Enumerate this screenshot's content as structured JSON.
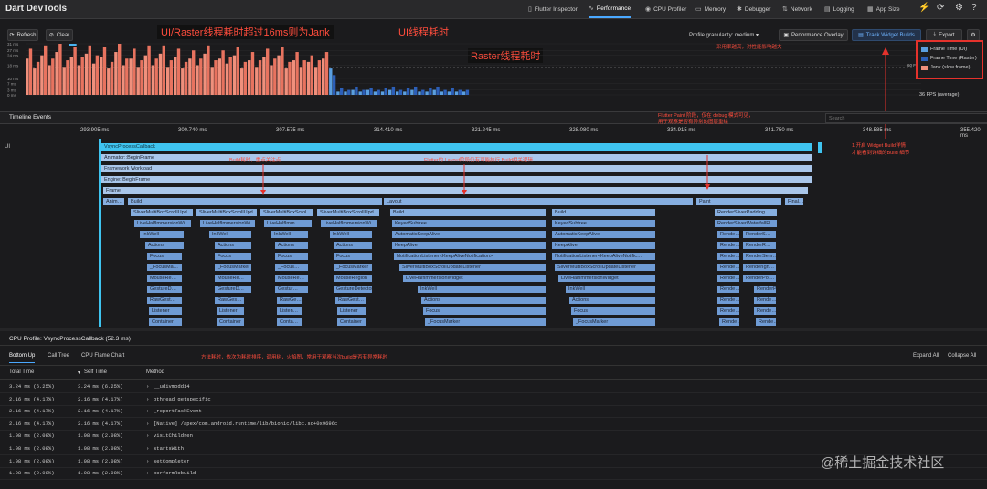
{
  "app": {
    "title": "Dart DevTools"
  },
  "nav": [
    {
      "label": "Flutter Inspector",
      "icon": "inspector-icon",
      "glyph": "▯"
    },
    {
      "label": "Performance",
      "icon": "performance-icon",
      "glyph": "∿"
    },
    {
      "label": "CPU Profiler",
      "icon": "cpu-icon",
      "glyph": "◉"
    },
    {
      "label": "Memory",
      "icon": "memory-icon",
      "glyph": "▭"
    },
    {
      "label": "Debugger",
      "icon": "debugger-icon",
      "glyph": "✱"
    },
    {
      "label": "Network",
      "icon": "network-icon",
      "glyph": "⇅"
    },
    {
      "label": "Logging",
      "icon": "logging-icon",
      "glyph": "▤"
    },
    {
      "label": "App Size",
      "icon": "app-size-icon",
      "glyph": "▦"
    }
  ],
  "toolbar": {
    "refresh_label": "Refresh",
    "clear_label": "Clear",
    "granularity_label": "Profile granularity: medium",
    "overlay_label": "Performance Overlay",
    "track_builds_label": "Track Widget Builds",
    "export_label": "Export"
  },
  "chart": {
    "y_ticks": [
      "31 ms",
      "27 ms",
      "24 ms",
      "18 ms",
      "10 ms",
      "7 ms",
      "3 ms",
      "0 ms"
    ],
    "fps_line_label": "60 FPS",
    "fps_avg": "36 FPS (average)",
    "legend": [
      {
        "label": "Frame Time (UI)",
        "color": "#5a9fe0"
      },
      {
        "label": "Frame Time (Raster)",
        "color": "#2c5fb8"
      },
      {
        "label": "Jank (slow frame)",
        "color": "#f0907c"
      }
    ]
  },
  "chart_data": {
    "type": "bar",
    "title": "",
    "ylabel": "",
    "ylim": [
      0,
      31
    ],
    "series": [
      {
        "name": "Frame Time (UI)",
        "values": [
          22,
          16,
          24,
          18,
          26,
          17,
          23,
          18,
          25,
          19,
          23,
          16,
          26,
          18,
          22,
          17,
          24,
          18,
          25,
          17,
          23,
          16,
          22,
          18,
          25,
          17,
          22,
          19,
          24,
          16,
          21,
          17,
          23,
          18,
          24,
          16,
          21,
          17,
          20,
          17,
          22,
          16,
          2,
          2,
          3,
          2,
          3,
          2,
          2,
          3,
          2,
          2,
          3,
          2,
          2,
          3,
          2,
          2,
          2,
          2
        ]
      },
      {
        "name": "Frame Time (Raster)",
        "values": [
          28,
          20,
          30,
          22,
          31,
          21,
          29,
          23,
          30,
          24,
          29,
          20,
          31,
          22,
          28,
          21,
          30,
          22,
          30,
          21,
          28,
          20,
          27,
          22,
          30,
          21,
          27,
          23,
          29,
          20,
          26,
          21,
          28,
          22,
          29,
          20,
          26,
          21,
          24,
          21,
          26,
          12,
          4,
          3,
          5,
          3,
          4,
          3,
          4,
          5,
          3,
          4,
          5,
          3,
          4,
          5,
          3,
          4,
          3,
          3
        ]
      }
    ]
  },
  "annotations": {
    "jank_note": "UI/Raster线程耗时超过16ms则为Jank",
    "ui_thread_note": "UI线程耗时",
    "raster_thread_note": "Raster线程耗时",
    "sampling_note": "采用率越高，对性能影响越大",
    "build_note": "Build耗时，重点关注点",
    "layout_note": "Flutter的 Layout阶段仍有可能执行 Build相关逻辑",
    "paint_note_1": "Flutter Paint 阶段，仅在 debug 模式可见，",
    "paint_note_2": "用于观察是否有异常的图层重绘",
    "widget_build_note_1": "1.开启 Widget Build详情",
    "widget_build_note_2": "才能看到详细的Build 细节",
    "cpu_note": "方法耗时，依次为耗时排序，调用树，火焰图，常用于观察当次build是否有异常耗时"
  },
  "timeline": {
    "title": "Timeline Events",
    "search_placeholder": "Search",
    "thread_label": "UI",
    "ticks": [
      "293.905 ms",
      "300.740 ms",
      "307.575 ms",
      "314.410 ms",
      "321.245 ms",
      "328.080 ms",
      "334.915 ms",
      "341.750 ms",
      "348.585 ms",
      "355.420 ms"
    ]
  },
  "flame": [
    {
      "l": "VsyncProcessCallback",
      "c": "cyan",
      "x": 110,
      "y": 0,
      "w": 780
    },
    {
      "l": "Animator::BeginFrame",
      "c": "b1",
      "x": 110,
      "y": 12,
      "w": 780
    },
    {
      "l": "Framework Workload",
      "c": "b1",
      "x": 110,
      "y": 24,
      "w": 780
    },
    {
      "l": "Engine::BeginFrame",
      "c": "b1",
      "x": 110,
      "y": 36,
      "w": 780
    },
    {
      "l": "Frame",
      "c": "b1",
      "x": 112,
      "y": 48,
      "w": 773
    },
    {
      "l": "Anim…",
      "c": "b2",
      "x": 112,
      "y": 60,
      "w": 25
    },
    {
      "l": "Build",
      "c": "b2",
      "x": 139,
      "y": 60,
      "w": 280
    },
    {
      "l": "Layout",
      "c": "b2",
      "x": 419,
      "y": 60,
      "w": 340
    },
    {
      "l": "Paint",
      "c": "b2",
      "x": 761,
      "y": 60,
      "w": 95
    },
    {
      "l": "Final…",
      "c": "b2",
      "x": 858,
      "y": 60,
      "w": 22
    },
    {
      "l": "SliverMultiBoxScrollUpd…",
      "c": "b2",
      "x": 142,
      "y": 72,
      "w": 70
    },
    {
      "l": "SliverMultiBoxScrollUpd…",
      "c": "b2",
      "x": 214,
      "y": 72,
      "w": 68
    },
    {
      "l": "SliverMultiBoxScrol…",
      "c": "b2",
      "x": 284,
      "y": 72,
      "w": 60
    },
    {
      "l": "SliverMultiBoxScrollUpd…",
      "c": "b2",
      "x": 346,
      "y": 72,
      "w": 70
    },
    {
      "l": "Build",
      "c": "b2",
      "x": 426,
      "y": 72,
      "w": 172
    },
    {
      "l": "Build",
      "c": "b2",
      "x": 603,
      "y": 72,
      "w": 115
    },
    {
      "l": "RenderSliverPadding",
      "c": "b2",
      "x": 781,
      "y": 72,
      "w": 70
    },
    {
      "l": "LiveHalfImmersionWi…",
      "c": "b3",
      "x": 146,
      "y": 84,
      "w": 64
    },
    {
      "l": "LiveHalfImmersionWi…",
      "c": "b3",
      "x": 218,
      "y": 84,
      "w": 62
    },
    {
      "l": "LiveHalfImm…",
      "c": "b3",
      "x": 288,
      "y": 84,
      "w": 54
    },
    {
      "l": "LiveHalfImmersionWi…",
      "c": "b3",
      "x": 350,
      "y": 84,
      "w": 64
    },
    {
      "l": "KeyedSubtree",
      "c": "b3",
      "x": 428,
      "y": 84,
      "w": 170
    },
    {
      "l": "KeyedSubtree",
      "c": "b3",
      "x": 603,
      "y": 84,
      "w": 115
    },
    {
      "l": "RenderSliverWaterfallFl…",
      "c": "b3",
      "x": 781,
      "y": 84,
      "w": 70
    },
    {
      "l": "InkWell",
      "c": "b3",
      "x": 152,
      "y": 96,
      "w": 50
    },
    {
      "l": "InkWell",
      "c": "b3",
      "x": 228,
      "y": 96,
      "w": 48
    },
    {
      "l": "InkWell",
      "c": "b3",
      "x": 296,
      "y": 96,
      "w": 42
    },
    {
      "l": "InkWell",
      "c": "b3",
      "x": 360,
      "y": 96,
      "w": 48
    },
    {
      "l": "AutomaticKeepAlive",
      "c": "b3",
      "x": 428,
      "y": 96,
      "w": 170
    },
    {
      "l": "AutomaticKeepAlive",
      "c": "b3",
      "x": 603,
      "y": 96,
      "w": 115
    },
    {
      "l": "Rende…",
      "c": "b3",
      "x": 784,
      "y": 96,
      "w": 26
    },
    {
      "l": "RenderS…",
      "c": "b3",
      "x": 812,
      "y": 96,
      "w": 38
    },
    {
      "l": "Actions",
      "c": "b3",
      "x": 158,
      "y": 108,
      "w": 44
    },
    {
      "l": "Actions",
      "c": "b3",
      "x": 234,
      "y": 108,
      "w": 42
    },
    {
      "l": "Actions",
      "c": "b3",
      "x": 300,
      "y": 108,
      "w": 38
    },
    {
      "l": "Actions",
      "c": "b3",
      "x": 364,
      "y": 108,
      "w": 44
    },
    {
      "l": "KeepAlive",
      "c": "b3",
      "x": 428,
      "y": 108,
      "w": 170
    },
    {
      "l": "KeepAlive",
      "c": "b3",
      "x": 603,
      "y": 108,
      "w": 115
    },
    {
      "l": "Rende…",
      "c": "b3",
      "x": 784,
      "y": 108,
      "w": 26
    },
    {
      "l": "RenderR…",
      "c": "b3",
      "x": 812,
      "y": 108,
      "w": 38
    },
    {
      "l": "Focus",
      "c": "b3",
      "x": 160,
      "y": 120,
      "w": 40
    },
    {
      "l": "Focus",
      "c": "b3",
      "x": 234,
      "y": 120,
      "w": 42
    },
    {
      "l": "Focus",
      "c": "b3",
      "x": 300,
      "y": 120,
      "w": 38
    },
    {
      "l": "Focus",
      "c": "b3",
      "x": 364,
      "y": 120,
      "w": 44
    },
    {
      "l": "NotificationListener<KeepAliveNotification>",
      "c": "b3",
      "x": 430,
      "y": 120,
      "w": 168
    },
    {
      "l": "NotificationListener<KeepAliveNotific…",
      "c": "b3",
      "x": 603,
      "y": 120,
      "w": 115
    },
    {
      "l": "Rende…",
      "c": "b3",
      "x": 784,
      "y": 120,
      "w": 26
    },
    {
      "l": "RenderSem…",
      "c": "b3",
      "x": 812,
      "y": 120,
      "w": 38
    },
    {
      "l": "_FocusMa…",
      "c": "b3",
      "x": 160,
      "y": 132,
      "w": 40
    },
    {
      "l": "_FocusMarker",
      "c": "b3",
      "x": 234,
      "y": 132,
      "w": 42
    },
    {
      "l": "_Focus…",
      "c": "b3",
      "x": 300,
      "y": 132,
      "w": 38
    },
    {
      "l": "_FocusMarker",
      "c": "b3",
      "x": 364,
      "y": 132,
      "w": 44
    },
    {
      "l": "SliverMultiBoxScrollUpdateListener",
      "c": "b3",
      "x": 436,
      "y": 132,
      "w": 162
    },
    {
      "l": "SliverMultiBoxScrollUpdateListener",
      "c": "b3",
      "x": 606,
      "y": 132,
      "w": 112
    },
    {
      "l": "Rende…",
      "c": "b3",
      "x": 784,
      "y": 132,
      "w": 26
    },
    {
      "l": "RenderIgn…",
      "c": "b3",
      "x": 812,
      "y": 132,
      "w": 38
    },
    {
      "l": "MouseRe…",
      "c": "b3",
      "x": 160,
      "y": 144,
      "w": 40
    },
    {
      "l": "MouseRe…",
      "c": "b3",
      "x": 234,
      "y": 144,
      "w": 42
    },
    {
      "l": "MouseRe…",
      "c": "b3",
      "x": 300,
      "y": 144,
      "w": 38
    },
    {
      "l": "MouseRegion",
      "c": "b3",
      "x": 364,
      "y": 144,
      "w": 44
    },
    {
      "l": "LiveHalfImmersionWidget",
      "c": "b3",
      "x": 440,
      "y": 144,
      "w": 158
    },
    {
      "l": "LiveHalfImmersionWidget",
      "c": "b3",
      "x": 610,
      "y": 144,
      "w": 108
    },
    {
      "l": "Rende…",
      "c": "b3",
      "x": 784,
      "y": 144,
      "w": 26
    },
    {
      "l": "RenderPoi…",
      "c": "b3",
      "x": 812,
      "y": 144,
      "w": 38
    },
    {
      "l": "GestureD…",
      "c": "b3",
      "x": 160,
      "y": 156,
      "w": 40
    },
    {
      "l": "GestureD…",
      "c": "b3",
      "x": 234,
      "y": 156,
      "w": 42
    },
    {
      "l": "Gestur…",
      "c": "b3",
      "x": 300,
      "y": 156,
      "w": 38
    },
    {
      "l": "GestureDetector",
      "c": "b3",
      "x": 364,
      "y": 156,
      "w": 44
    },
    {
      "l": "InkWell",
      "c": "b3",
      "x": 456,
      "y": 156,
      "w": 142
    },
    {
      "l": "InkWell",
      "c": "b3",
      "x": 618,
      "y": 156,
      "w": 100
    },
    {
      "l": "Rende…",
      "c": "b3",
      "x": 784,
      "y": 156,
      "w": 26
    },
    {
      "l": "RenderPoi…",
      "c": "b3",
      "x": 824,
      "y": 156,
      "w": 26
    },
    {
      "l": "RawGest…",
      "c": "b3",
      "x": 160,
      "y": 168,
      "w": 40
    },
    {
      "l": "RawGes…",
      "c": "b3",
      "x": 234,
      "y": 168,
      "w": 34
    },
    {
      "l": "RawGe…",
      "c": "b3",
      "x": 302,
      "y": 168,
      "w": 30
    },
    {
      "l": "RawGest…",
      "c": "b3",
      "x": 366,
      "y": 168,
      "w": 36
    },
    {
      "l": "Actions",
      "c": "b3",
      "x": 460,
      "y": 168,
      "w": 138
    },
    {
      "l": "Actions",
      "c": "b3",
      "x": 622,
      "y": 168,
      "w": 96
    },
    {
      "l": "Rende…",
      "c": "b3",
      "x": 784,
      "y": 168,
      "w": 26
    },
    {
      "l": "Rende…",
      "c": "b3",
      "x": 824,
      "y": 168,
      "w": 26
    },
    {
      "l": "Listener",
      "c": "b3",
      "x": 162,
      "y": 180,
      "w": 38
    },
    {
      "l": "Listener",
      "c": "b3",
      "x": 236,
      "y": 180,
      "w": 32
    },
    {
      "l": "Listen…",
      "c": "b3",
      "x": 302,
      "y": 180,
      "w": 30
    },
    {
      "l": "Listener",
      "c": "b3",
      "x": 368,
      "y": 180,
      "w": 34
    },
    {
      "l": "Focus",
      "c": "b3",
      "x": 462,
      "y": 180,
      "w": 136
    },
    {
      "l": "Focus",
      "c": "b3",
      "x": 624,
      "y": 180,
      "w": 94
    },
    {
      "l": "Rende…",
      "c": "b3",
      "x": 784,
      "y": 180,
      "w": 26
    },
    {
      "l": "Rende…",
      "c": "b3",
      "x": 824,
      "y": 180,
      "w": 26
    },
    {
      "l": "Container",
      "c": "b3",
      "x": 162,
      "y": 192,
      "w": 38
    },
    {
      "l": "Container",
      "c": "b3",
      "x": 236,
      "y": 192,
      "w": 32
    },
    {
      "l": "Conta…",
      "c": "b3",
      "x": 302,
      "y": 192,
      "w": 30
    },
    {
      "l": "Container",
      "c": "b3",
      "x": 368,
      "y": 192,
      "w": 34
    },
    {
      "l": "_FocusMarker",
      "c": "b3",
      "x": 464,
      "y": 192,
      "w": 134
    },
    {
      "l": "_FocusMarker",
      "c": "b3",
      "x": 626,
      "y": 192,
      "w": 92
    },
    {
      "l": "Rende…",
      "c": "b3",
      "x": 786,
      "y": 192,
      "w": 24
    },
    {
      "l": "Rende…",
      "c": "b3",
      "x": 826,
      "y": 192,
      "w": 24
    }
  ],
  "cpu": {
    "title": "CPU Profile: VsyncProcessCallback (52.3 ms)",
    "tabs": [
      "Bottom Up",
      "Call Tree",
      "CPU Flame Chart"
    ],
    "expand_all": "Expand All",
    "collapse_all": "Collapse All",
    "columns": [
      "Total Time",
      "Self Time",
      "Method"
    ],
    "rows": [
      {
        "total": "3.24 ms (6.25%)",
        "self": "3.24 ms (6.25%)",
        "method": "__udivmoddi4"
      },
      {
        "total": "2.16 ms (4.17%)",
        "self": "2.16 ms (4.17%)",
        "method": "pthread_getspecific"
      },
      {
        "total": "2.16 ms (4.17%)",
        "self": "2.16 ms (4.17%)",
        "method": "_reportTaskEvent"
      },
      {
        "total": "2.16 ms (4.17%)",
        "self": "2.16 ms (4.17%)",
        "method": "[Native] /apex/com.android.runtime/lib/bionic/libc.so+0x9696c"
      },
      {
        "total": "1.08 ms (2.08%)",
        "self": "1.08 ms (2.08%)",
        "method": "visitChildren"
      },
      {
        "total": "1.08 ms (2.08%)",
        "self": "1.08 ms (2.08%)",
        "method": "startsWith"
      },
      {
        "total": "1.08 ms (2.08%)",
        "self": "1.08 ms (2.08%)",
        "method": "setCompleter"
      },
      {
        "total": "1.08 ms (2.08%)",
        "self": "1.08 ms (2.08%)",
        "method": "performRebuild"
      }
    ]
  },
  "watermark": "@稀土掘金技术社区"
}
